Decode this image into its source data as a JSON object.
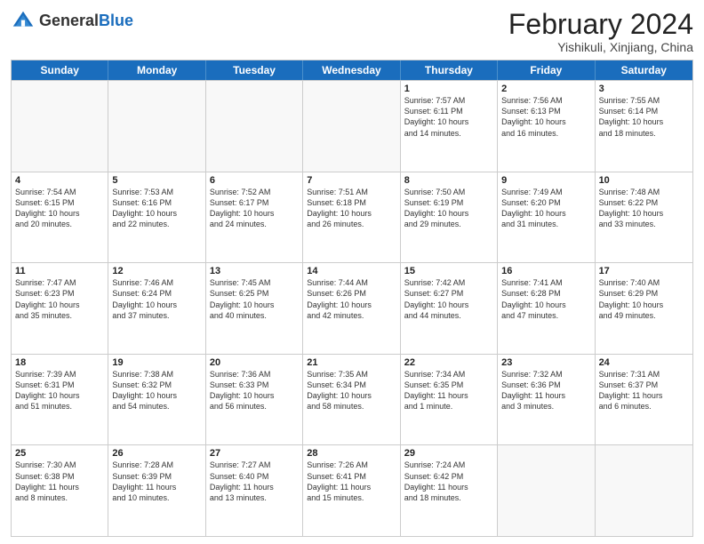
{
  "header": {
    "logo_line1": "General",
    "logo_line2": "Blue",
    "month_year": "February 2024",
    "location": "Yishikuli, Xinjiang, China"
  },
  "weekdays": [
    "Sunday",
    "Monday",
    "Tuesday",
    "Wednesday",
    "Thursday",
    "Friday",
    "Saturday"
  ],
  "rows": [
    [
      {
        "day": "",
        "info": ""
      },
      {
        "day": "",
        "info": ""
      },
      {
        "day": "",
        "info": ""
      },
      {
        "day": "",
        "info": ""
      },
      {
        "day": "1",
        "info": "Sunrise: 7:57 AM\nSunset: 6:11 PM\nDaylight: 10 hours\nand 14 minutes."
      },
      {
        "day": "2",
        "info": "Sunrise: 7:56 AM\nSunset: 6:13 PM\nDaylight: 10 hours\nand 16 minutes."
      },
      {
        "day": "3",
        "info": "Sunrise: 7:55 AM\nSunset: 6:14 PM\nDaylight: 10 hours\nand 18 minutes."
      }
    ],
    [
      {
        "day": "4",
        "info": "Sunrise: 7:54 AM\nSunset: 6:15 PM\nDaylight: 10 hours\nand 20 minutes."
      },
      {
        "day": "5",
        "info": "Sunrise: 7:53 AM\nSunset: 6:16 PM\nDaylight: 10 hours\nand 22 minutes."
      },
      {
        "day": "6",
        "info": "Sunrise: 7:52 AM\nSunset: 6:17 PM\nDaylight: 10 hours\nand 24 minutes."
      },
      {
        "day": "7",
        "info": "Sunrise: 7:51 AM\nSunset: 6:18 PM\nDaylight: 10 hours\nand 26 minutes."
      },
      {
        "day": "8",
        "info": "Sunrise: 7:50 AM\nSunset: 6:19 PM\nDaylight: 10 hours\nand 29 minutes."
      },
      {
        "day": "9",
        "info": "Sunrise: 7:49 AM\nSunset: 6:20 PM\nDaylight: 10 hours\nand 31 minutes."
      },
      {
        "day": "10",
        "info": "Sunrise: 7:48 AM\nSunset: 6:22 PM\nDaylight: 10 hours\nand 33 minutes."
      }
    ],
    [
      {
        "day": "11",
        "info": "Sunrise: 7:47 AM\nSunset: 6:23 PM\nDaylight: 10 hours\nand 35 minutes."
      },
      {
        "day": "12",
        "info": "Sunrise: 7:46 AM\nSunset: 6:24 PM\nDaylight: 10 hours\nand 37 minutes."
      },
      {
        "day": "13",
        "info": "Sunrise: 7:45 AM\nSunset: 6:25 PM\nDaylight: 10 hours\nand 40 minutes."
      },
      {
        "day": "14",
        "info": "Sunrise: 7:44 AM\nSunset: 6:26 PM\nDaylight: 10 hours\nand 42 minutes."
      },
      {
        "day": "15",
        "info": "Sunrise: 7:42 AM\nSunset: 6:27 PM\nDaylight: 10 hours\nand 44 minutes."
      },
      {
        "day": "16",
        "info": "Sunrise: 7:41 AM\nSunset: 6:28 PM\nDaylight: 10 hours\nand 47 minutes."
      },
      {
        "day": "17",
        "info": "Sunrise: 7:40 AM\nSunset: 6:29 PM\nDaylight: 10 hours\nand 49 minutes."
      }
    ],
    [
      {
        "day": "18",
        "info": "Sunrise: 7:39 AM\nSunset: 6:31 PM\nDaylight: 10 hours\nand 51 minutes."
      },
      {
        "day": "19",
        "info": "Sunrise: 7:38 AM\nSunset: 6:32 PM\nDaylight: 10 hours\nand 54 minutes."
      },
      {
        "day": "20",
        "info": "Sunrise: 7:36 AM\nSunset: 6:33 PM\nDaylight: 10 hours\nand 56 minutes."
      },
      {
        "day": "21",
        "info": "Sunrise: 7:35 AM\nSunset: 6:34 PM\nDaylight: 10 hours\nand 58 minutes."
      },
      {
        "day": "22",
        "info": "Sunrise: 7:34 AM\nSunset: 6:35 PM\nDaylight: 11 hours\nand 1 minute."
      },
      {
        "day": "23",
        "info": "Sunrise: 7:32 AM\nSunset: 6:36 PM\nDaylight: 11 hours\nand 3 minutes."
      },
      {
        "day": "24",
        "info": "Sunrise: 7:31 AM\nSunset: 6:37 PM\nDaylight: 11 hours\nand 6 minutes."
      }
    ],
    [
      {
        "day": "25",
        "info": "Sunrise: 7:30 AM\nSunset: 6:38 PM\nDaylight: 11 hours\nand 8 minutes."
      },
      {
        "day": "26",
        "info": "Sunrise: 7:28 AM\nSunset: 6:39 PM\nDaylight: 11 hours\nand 10 minutes."
      },
      {
        "day": "27",
        "info": "Sunrise: 7:27 AM\nSunset: 6:40 PM\nDaylight: 11 hours\nand 13 minutes."
      },
      {
        "day": "28",
        "info": "Sunrise: 7:26 AM\nSunset: 6:41 PM\nDaylight: 11 hours\nand 15 minutes."
      },
      {
        "day": "29",
        "info": "Sunrise: 7:24 AM\nSunset: 6:42 PM\nDaylight: 11 hours\nand 18 minutes."
      },
      {
        "day": "",
        "info": ""
      },
      {
        "day": "",
        "info": ""
      }
    ]
  ]
}
